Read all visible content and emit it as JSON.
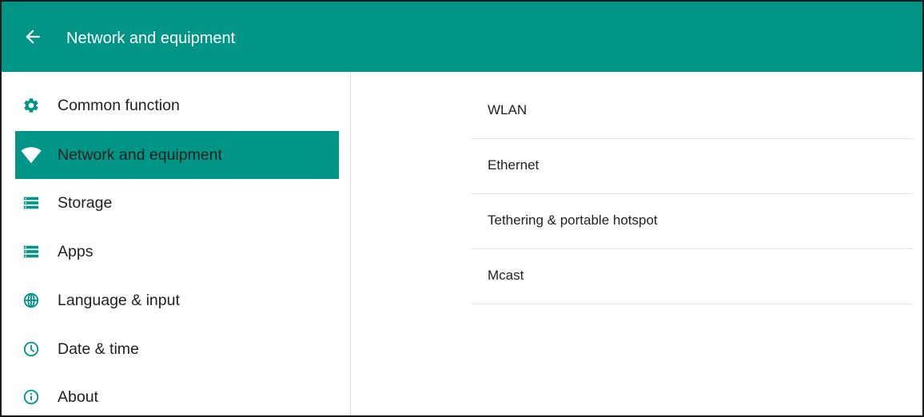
{
  "app_bar": {
    "back_icon": "arrow-back-icon",
    "title": "Network and equipment",
    "color": "#009587"
  },
  "sidebar": {
    "active_color": "#009587",
    "items": [
      {
        "label": "Common function",
        "icon": "gear-icon",
        "active": false
      },
      {
        "label": "Network and equipment",
        "icon": "wifi-icon",
        "active": true
      },
      {
        "label": "Storage",
        "icon": "storage-icon",
        "active": false
      },
      {
        "label": "Apps",
        "icon": "apps-list-icon",
        "active": false
      },
      {
        "label": "Language & input",
        "icon": "globe-icon",
        "active": false
      },
      {
        "label": "Date & time",
        "icon": "clock-icon",
        "active": false
      },
      {
        "label": "About",
        "icon": "info-icon",
        "active": false
      }
    ]
  },
  "content": {
    "items": [
      {
        "label": "WLAN"
      },
      {
        "label": "Ethernet"
      },
      {
        "label": "Tethering & portable hotspot"
      },
      {
        "label": "Mcast"
      }
    ]
  }
}
